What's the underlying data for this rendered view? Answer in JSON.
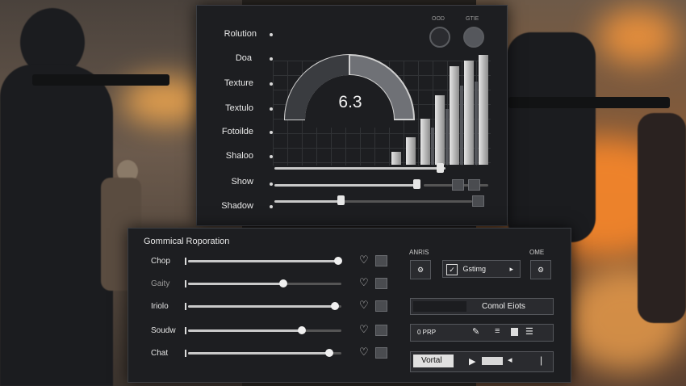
{
  "top_panel": {
    "labels": [
      "Rolution",
      "Doa",
      "Texture",
      "Textulo",
      "Fotoilde",
      "Shaloo",
      "Show",
      "Shadow"
    ],
    "gauge_value": "6.3",
    "header_circle_labels": [
      "OOD",
      "GTIE"
    ],
    "bar_heights": [
      0.12,
      0.25,
      0.42,
      0.63,
      0.9,
      0.95,
      1.0
    ],
    "slider_levels": [
      0.92,
      0.7,
      0.3
    ]
  },
  "bottom_panel": {
    "title": "Gommical Roporation",
    "rows": [
      {
        "label": "Chop",
        "level": 0.98
      },
      {
        "label": "Gaity",
        "level": 0.62
      },
      {
        "label": "Iriolo",
        "level": 0.96
      },
      {
        "label": "Soudw",
        "level": 0.74
      },
      {
        "label": "Chat",
        "level": 0.92
      }
    ],
    "right_headers": [
      "ANRIS",
      "OME"
    ],
    "dropdown_value": "Gstimg",
    "control_button": "Comol Eiots",
    "field_value": "0 PRP",
    "vorted_label": "Vortal"
  },
  "colors": {
    "panel": "#1d1e21",
    "text": "#e9e9e9",
    "slider": "#c9c9c9"
  }
}
